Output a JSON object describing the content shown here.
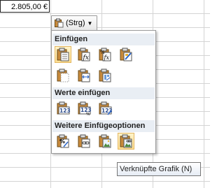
{
  "cell": {
    "value": "2.805,00 €"
  },
  "paste_options": {
    "button_label": "(Strg)"
  },
  "menu": {
    "sections": [
      {
        "title": "Einfügen"
      },
      {
        "title": "Werte einfügen"
      },
      {
        "title": "Weitere Einfügeoptionen"
      }
    ]
  },
  "tooltip": {
    "text": "Verknüpfte Grafik (N)"
  }
}
